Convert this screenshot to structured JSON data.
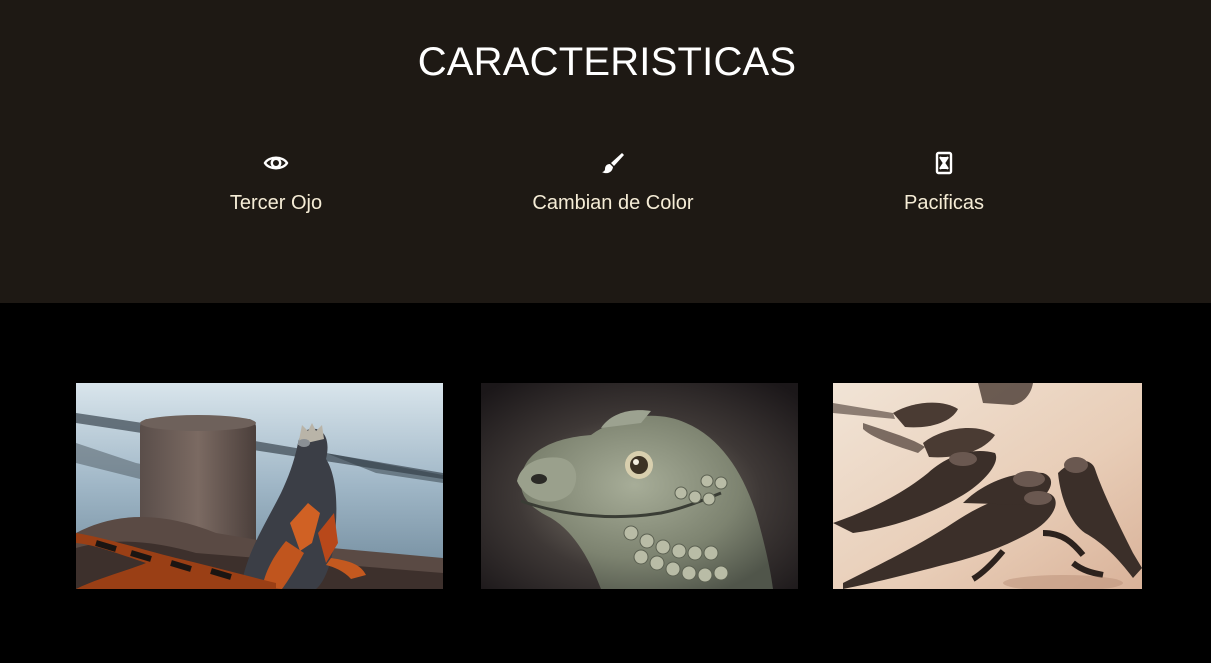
{
  "features": {
    "title": "CARACTERISTICAS",
    "items": [
      {
        "icon": "eye-icon",
        "label": "Tercer Ojo"
      },
      {
        "icon": "paint-brush-icon",
        "label": "Cambian de Color"
      },
      {
        "icon": "hourglass-icon",
        "label": "Pacificas"
      }
    ]
  },
  "gallery": {
    "images": [
      {
        "subject": "iguana-on-rocks-by-water"
      },
      {
        "subject": "iguana-head-closeup"
      },
      {
        "subject": "group-of-iguanas-on-sand"
      }
    ]
  },
  "colors": {
    "features_bg": "#1e1914",
    "page_bg": "#000000",
    "title_text": "#ffffff",
    "label_text": "#f5ecd6"
  }
}
